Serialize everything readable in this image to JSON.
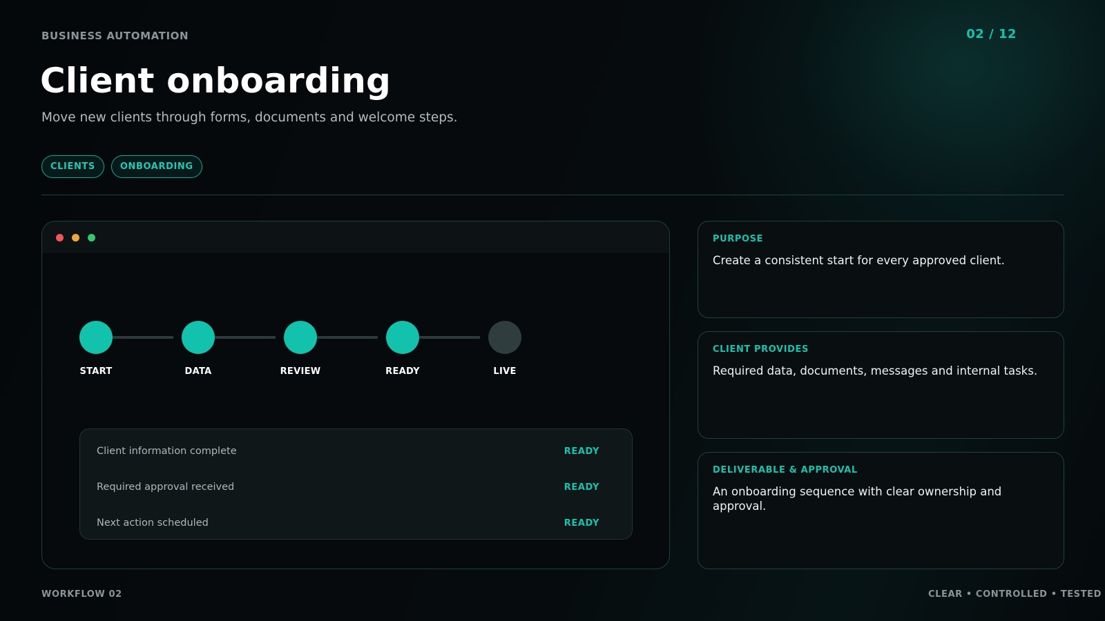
{
  "header": {
    "eyebrow": "BUSINESS AUTOMATION",
    "counter": "02 / 12",
    "title": "Client onboarding",
    "subtitle": "Move new clients through forms, documents and welcome steps."
  },
  "tags": [
    "CLIENTS",
    "ONBOARDING"
  ],
  "window": {
    "steps": [
      {
        "label": "START",
        "done": true
      },
      {
        "label": "DATA",
        "done": true
      },
      {
        "label": "REVIEW",
        "done": true
      },
      {
        "label": "READY",
        "done": true
      },
      {
        "label": "LIVE",
        "done": false
      }
    ],
    "checklist": [
      {
        "text": "Client information complete",
        "status": "READY"
      },
      {
        "text": "Required approval received",
        "status": "READY"
      },
      {
        "text": "Next action scheduled",
        "status": "READY"
      }
    ]
  },
  "cards": [
    {
      "label": "PURPOSE",
      "text": "Create a consistent start for every approved client."
    },
    {
      "label": "CLIENT PROVIDES",
      "text": "Required data, documents, messages and internal tasks."
    },
    {
      "label": "DELIVERABLE & APPROVAL",
      "text": "An onboarding sequence with clear ownership and approval."
    }
  ],
  "footer": {
    "left": "WORKFLOW 02",
    "right": "CLEAR • CONTROLLED • TESTED"
  },
  "colors": {
    "accent": "#18c3ae",
    "pending_step": "#2f3d3e",
    "background": "#05090b"
  }
}
